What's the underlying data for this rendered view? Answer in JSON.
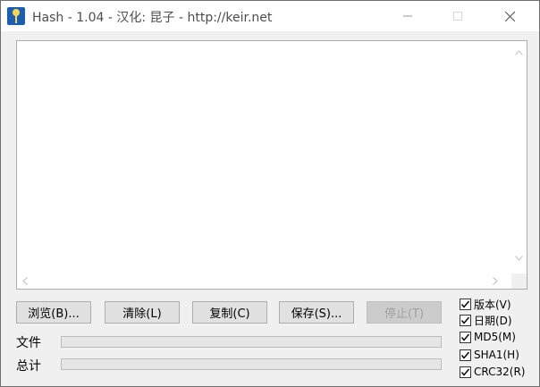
{
  "window": {
    "title": "Hash - 1.04 - 汉化: 昆子 - http://keir.net"
  },
  "buttons": {
    "browse": "浏览(B)...",
    "clear": "清除(L)",
    "copy": "复制(C)",
    "save": "保存(S)...",
    "stop": "停止(T)"
  },
  "labels": {
    "file": "文件",
    "total": "总计"
  },
  "progress": {
    "file": 0,
    "total": 0
  },
  "options": [
    {
      "label": "版本(V)",
      "checked": true
    },
    {
      "label": "日期(D)",
      "checked": true
    },
    {
      "label": "MD5(M)",
      "checked": true
    },
    {
      "label": "SHA1(H)",
      "checked": true
    },
    {
      "label": "CRC32(R)",
      "checked": true
    }
  ]
}
